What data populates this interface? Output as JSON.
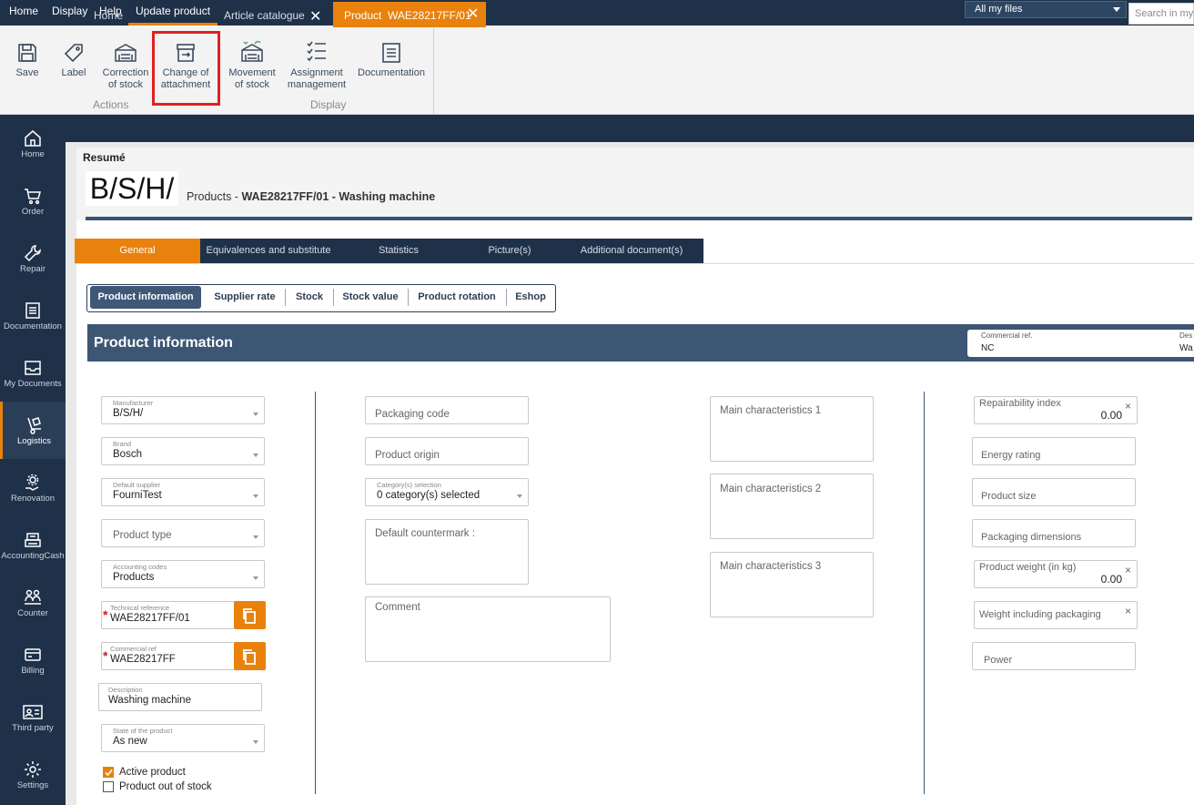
{
  "menubar": {
    "items": [
      "Home",
      "Display",
      "Help",
      "Update product"
    ],
    "scope": "All my files",
    "search_placeholder": "Search in my"
  },
  "ribbon": {
    "buttons": [
      {
        "label": "Save",
        "icon": "save-icon"
      },
      {
        "label": "Label",
        "icon": "tag-icon"
      },
      {
        "label1": "Correction",
        "label2": "of stock",
        "icon": "stock-correction-icon"
      },
      {
        "label1": "Change of",
        "label2": "attachment",
        "icon": "archive-box-icon"
      },
      {
        "label1": "Movement",
        "label2": "of stock",
        "icon": "stock-movement-icon"
      },
      {
        "label1": "Assignment",
        "label2": "management",
        "icon": "checklist-icon"
      },
      {
        "label": "Documentation",
        "icon": "document-icon"
      }
    ],
    "group_actions": "Actions",
    "group_display": "Display"
  },
  "leftnav": [
    "Home",
    "Order",
    "Repair",
    "Documentation",
    "My Documents",
    "Logistics",
    "Renovation",
    "AccountingCash",
    "Counter",
    "Billing",
    "Third party",
    "Settings"
  ],
  "doctabs": {
    "home": "Home",
    "catalogue": "Article catalogue",
    "product": "Product  WAE28217FF/01",
    "close": "✕"
  },
  "resume": {
    "label": "Resumé",
    "logo": "B/S/H/",
    "title_prefix": "Products - ",
    "title_main": "WAE28217FF/01 - Washing machine"
  },
  "section_tabs": [
    "General",
    "Equivalences and substitute",
    "Statistics",
    "Picture(s)",
    "Additional document(s)"
  ],
  "sub_tabs": [
    "Product information",
    "Supplier rate",
    "Stock",
    "Stock value",
    "Product rotation",
    "Eshop"
  ],
  "pi": {
    "title": "Product information",
    "commercial_ref_label": "Commercial ref.",
    "commercial_ref_value": "NC",
    "desc_label_trunc": "Des",
    "desc_value_trunc": "Wa"
  },
  "col1": {
    "manufacturer": {
      "label": "Manufacturer",
      "value": "B/S/H/"
    },
    "brand": {
      "label": "Brand",
      "value": "Bosch"
    },
    "default_supplier": {
      "label": "Default supplier",
      "value": "FourniTest"
    },
    "product_type": {
      "placeholder": "Product type"
    },
    "accounting_codes": {
      "label": "Accounting codes",
      "value": "Products"
    },
    "technical_reference": {
      "label": "Technical reference",
      "value": "WAE28217FF/01"
    },
    "commercial_ref": {
      "label": "Commercial ref",
      "value": "WAE28217FF"
    },
    "description": {
      "label": "Description",
      "value": "Washing machine"
    },
    "state": {
      "label": "State of the product",
      "value": "As new"
    },
    "active_product": "Active product",
    "out_of_stock": "Product out of stock",
    "required_mark": "*"
  },
  "col2": {
    "packaging_code": "Packaging code",
    "product_origin": "Product origin",
    "category": {
      "label": "Category(s) selection",
      "value": "0 category(s) selected"
    },
    "countermark": "Default countermark :",
    "comment": "Comment"
  },
  "col3": {
    "char1": "Main characteristics 1",
    "char2": "Main characteristics 2",
    "char3": "Main characteristics 3"
  },
  "col4": {
    "repairability": {
      "label": "Repairability index",
      "value": "0.00"
    },
    "energy_rating": "Energy rating",
    "product_size": "Product size",
    "packaging_dimensions": "Packaging dimensions",
    "weight": {
      "label": "Product weight (in kg)",
      "value": "0.00"
    },
    "weight_packaging": "Weight including packaging",
    "power": "Power",
    "clear": "×"
  }
}
